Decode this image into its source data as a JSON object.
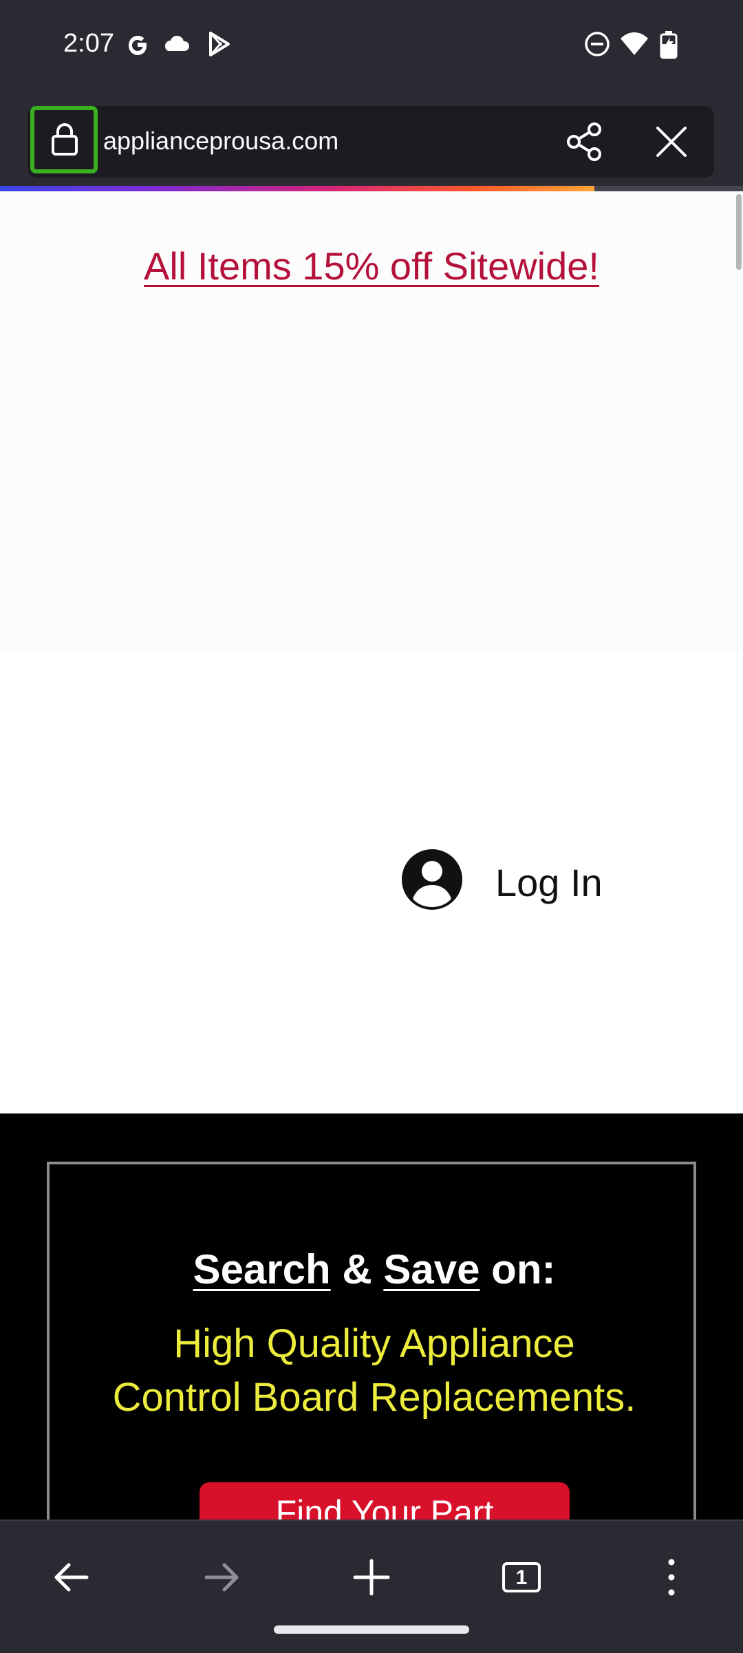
{
  "status_bar": {
    "time": "2:07",
    "left_icons": [
      "google-icon",
      "cloud-icon",
      "play-store-icon"
    ],
    "right_icons": [
      "dnd-icon",
      "wifi-icon",
      "battery-charging-icon"
    ]
  },
  "url_bar": {
    "url": "applianceprousa.com",
    "icons": [
      "lock-icon",
      "share-icon",
      "close-icon"
    ],
    "load_progress": 0.8
  },
  "page": {
    "promo": "All Items 15% off Sitewide!",
    "login_label": "Log In",
    "banner": {
      "title_part1": "Search",
      "title_part2": " & ",
      "title_part3": "Save",
      "title_part4": " on:",
      "subtitle_line1": "High Quality Appliance",
      "subtitle_line2": "Control Board Replacements.",
      "button_label": "Find Your Part"
    }
  },
  "toolbar": {
    "tab_count": "1",
    "icons": [
      "back-icon",
      "forward-icon",
      "new-tab-icon",
      "tabs-icon",
      "menu-icon"
    ]
  },
  "colors": {
    "highlight": "#3ab01f",
    "promo": "#b4103a",
    "subtitle": "#ecec3c",
    "button": "#d8102a"
  }
}
